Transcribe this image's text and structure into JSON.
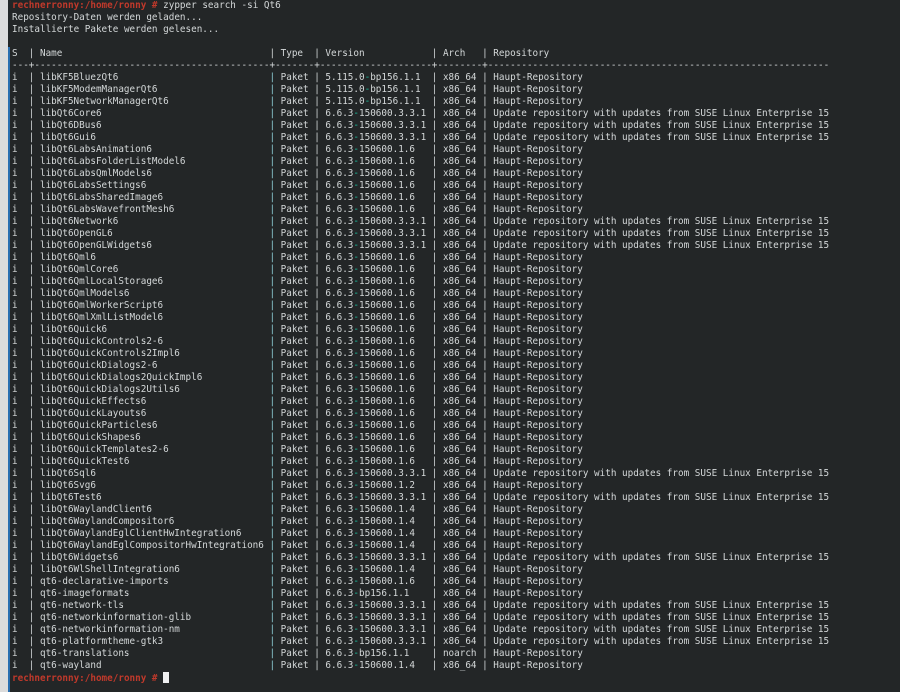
{
  "terminal": {
    "prompt": "rechnerronny:/home/ronny #",
    "command": "zypper search -si Qt6",
    "messages": [
      "Repository-Daten werden geladen...",
      "Installierte Pakete werden gelesen..."
    ],
    "headers": {
      "status": "S",
      "name": "Name",
      "type": "Type",
      "version": "Version",
      "arch": "Arch",
      "repository": "Repository"
    },
    "rows": [
      {
        "s": "i",
        "name": "libKF5BluezQt6",
        "type": "Paket",
        "ver": "5.115.0",
        "rel": "bp156.1.1",
        "arch": "x86_64",
        "repo": "Haupt-Repository"
      },
      {
        "s": "i",
        "name": "libKF5ModemManagerQt6",
        "type": "Paket",
        "ver": "5.115.0",
        "rel": "bp156.1.1",
        "arch": "x86_64",
        "repo": "Haupt-Repository"
      },
      {
        "s": "i",
        "name": "libKF5NetworkManagerQt6",
        "type": "Paket",
        "ver": "5.115.0",
        "rel": "bp156.1.1",
        "arch": "x86_64",
        "repo": "Haupt-Repository"
      },
      {
        "s": "i",
        "name": "libQt6Core6",
        "type": "Paket",
        "ver": "6.6.3",
        "rel": "150600.3.3.1",
        "arch": "x86_64",
        "repo": "Update repository with updates from SUSE Linux Enterprise 15"
      },
      {
        "s": "i",
        "name": "libQt6DBus6",
        "type": "Paket",
        "ver": "6.6.3",
        "rel": "150600.3.3.1",
        "arch": "x86_64",
        "repo": "Update repository with updates from SUSE Linux Enterprise 15"
      },
      {
        "s": "i",
        "name": "libQt6Gui6",
        "type": "Paket",
        "ver": "6.6.3",
        "rel": "150600.3.3.1",
        "arch": "x86_64",
        "repo": "Update repository with updates from SUSE Linux Enterprise 15"
      },
      {
        "s": "i",
        "name": "libQt6LabsAnimation6",
        "type": "Paket",
        "ver": "6.6.3",
        "rel": "150600.1.6",
        "arch": "x86_64",
        "repo": "Haupt-Repository"
      },
      {
        "s": "i",
        "name": "libQt6LabsFolderListModel6",
        "type": "Paket",
        "ver": "6.6.3",
        "rel": "150600.1.6",
        "arch": "x86_64",
        "repo": "Haupt-Repository"
      },
      {
        "s": "i",
        "name": "libQt6LabsQmlModels6",
        "type": "Paket",
        "ver": "6.6.3",
        "rel": "150600.1.6",
        "arch": "x86_64",
        "repo": "Haupt-Repository"
      },
      {
        "s": "i",
        "name": "libQt6LabsSettings6",
        "type": "Paket",
        "ver": "6.6.3",
        "rel": "150600.1.6",
        "arch": "x86_64",
        "repo": "Haupt-Repository"
      },
      {
        "s": "i",
        "name": "libQt6LabsSharedImage6",
        "type": "Paket",
        "ver": "6.6.3",
        "rel": "150600.1.6",
        "arch": "x86_64",
        "repo": "Haupt-Repository"
      },
      {
        "s": "i",
        "name": "libQt6LabsWavefrontMesh6",
        "type": "Paket",
        "ver": "6.6.3",
        "rel": "150600.1.6",
        "arch": "x86_64",
        "repo": "Haupt-Repository"
      },
      {
        "s": "i",
        "name": "libQt6Network6",
        "type": "Paket",
        "ver": "6.6.3",
        "rel": "150600.3.3.1",
        "arch": "x86_64",
        "repo": "Update repository with updates from SUSE Linux Enterprise 15"
      },
      {
        "s": "i",
        "name": "libQt6OpenGL6",
        "type": "Paket",
        "ver": "6.6.3",
        "rel": "150600.3.3.1",
        "arch": "x86_64",
        "repo": "Update repository with updates from SUSE Linux Enterprise 15"
      },
      {
        "s": "i",
        "name": "libQt6OpenGLWidgets6",
        "type": "Paket",
        "ver": "6.6.3",
        "rel": "150600.3.3.1",
        "arch": "x86_64",
        "repo": "Update repository with updates from SUSE Linux Enterprise 15"
      },
      {
        "s": "i",
        "name": "libQt6Qml6",
        "type": "Paket",
        "ver": "6.6.3",
        "rel": "150600.1.6",
        "arch": "x86_64",
        "repo": "Haupt-Repository"
      },
      {
        "s": "i",
        "name": "libQt6QmlCore6",
        "type": "Paket",
        "ver": "6.6.3",
        "rel": "150600.1.6",
        "arch": "x86_64",
        "repo": "Haupt-Repository"
      },
      {
        "s": "i",
        "name": "libQt6QmlLocalStorage6",
        "type": "Paket",
        "ver": "6.6.3",
        "rel": "150600.1.6",
        "arch": "x86_64",
        "repo": "Haupt-Repository"
      },
      {
        "s": "i",
        "name": "libQt6QmlModels6",
        "type": "Paket",
        "ver": "6.6.3",
        "rel": "150600.1.6",
        "arch": "x86_64",
        "repo": "Haupt-Repository"
      },
      {
        "s": "i",
        "name": "libQt6QmlWorkerScript6",
        "type": "Paket",
        "ver": "6.6.3",
        "rel": "150600.1.6",
        "arch": "x86_64",
        "repo": "Haupt-Repository"
      },
      {
        "s": "i",
        "name": "libQt6QmlXmlListModel6",
        "type": "Paket",
        "ver": "6.6.3",
        "rel": "150600.1.6",
        "arch": "x86_64",
        "repo": "Haupt-Repository"
      },
      {
        "s": "i",
        "name": "libQt6Quick6",
        "type": "Paket",
        "ver": "6.6.3",
        "rel": "150600.1.6",
        "arch": "x86_64",
        "repo": "Haupt-Repository"
      },
      {
        "s": "i",
        "name": "libQt6QuickControls2-6",
        "type": "Paket",
        "ver": "6.6.3",
        "rel": "150600.1.6",
        "arch": "x86_64",
        "repo": "Haupt-Repository"
      },
      {
        "s": "i",
        "name": "libQt6QuickControls2Impl6",
        "type": "Paket",
        "ver": "6.6.3",
        "rel": "150600.1.6",
        "arch": "x86_64",
        "repo": "Haupt-Repository"
      },
      {
        "s": "i",
        "name": "libQt6QuickDialogs2-6",
        "type": "Paket",
        "ver": "6.6.3",
        "rel": "150600.1.6",
        "arch": "x86_64",
        "repo": "Haupt-Repository"
      },
      {
        "s": "i",
        "name": "libQt6QuickDialogs2QuickImpl6",
        "type": "Paket",
        "ver": "6.6.3",
        "rel": "150600.1.6",
        "arch": "x86_64",
        "repo": "Haupt-Repository"
      },
      {
        "s": "i",
        "name": "libQt6QuickDialogs2Utils6",
        "type": "Paket",
        "ver": "6.6.3",
        "rel": "150600.1.6",
        "arch": "x86_64",
        "repo": "Haupt-Repository"
      },
      {
        "s": "i",
        "name": "libQt6QuickEffects6",
        "type": "Paket",
        "ver": "6.6.3",
        "rel": "150600.1.6",
        "arch": "x86_64",
        "repo": "Haupt-Repository"
      },
      {
        "s": "i",
        "name": "libQt6QuickLayouts6",
        "type": "Paket",
        "ver": "6.6.3",
        "rel": "150600.1.6",
        "arch": "x86_64",
        "repo": "Haupt-Repository"
      },
      {
        "s": "i",
        "name": "libQt6QuickParticles6",
        "type": "Paket",
        "ver": "6.6.3",
        "rel": "150600.1.6",
        "arch": "x86_64",
        "repo": "Haupt-Repository"
      },
      {
        "s": "i",
        "name": "libQt6QuickShapes6",
        "type": "Paket",
        "ver": "6.6.3",
        "rel": "150600.1.6",
        "arch": "x86_64",
        "repo": "Haupt-Repository"
      },
      {
        "s": "i",
        "name": "libQt6QuickTemplates2-6",
        "type": "Paket",
        "ver": "6.6.3",
        "rel": "150600.1.6",
        "arch": "x86_64",
        "repo": "Haupt-Repository"
      },
      {
        "s": "i",
        "name": "libQt6QuickTest6",
        "type": "Paket",
        "ver": "6.6.3",
        "rel": "150600.1.6",
        "arch": "x86_64",
        "repo": "Haupt-Repository"
      },
      {
        "s": "i",
        "name": "libQt6Sql6",
        "type": "Paket",
        "ver": "6.6.3",
        "rel": "150600.3.3.1",
        "arch": "x86_64",
        "repo": "Update repository with updates from SUSE Linux Enterprise 15"
      },
      {
        "s": "i",
        "name": "libQt6Svg6",
        "type": "Paket",
        "ver": "6.6.3",
        "rel": "150600.1.2",
        "arch": "x86_64",
        "repo": "Haupt-Repository"
      },
      {
        "s": "i",
        "name": "libQt6Test6",
        "type": "Paket",
        "ver": "6.6.3",
        "rel": "150600.3.3.1",
        "arch": "x86_64",
        "repo": "Update repository with updates from SUSE Linux Enterprise 15"
      },
      {
        "s": "i",
        "name": "libQt6WaylandClient6",
        "type": "Paket",
        "ver": "6.6.3",
        "rel": "150600.1.4",
        "arch": "x86_64",
        "repo": "Haupt-Repository"
      },
      {
        "s": "i",
        "name": "libQt6WaylandCompositor6",
        "type": "Paket",
        "ver": "6.6.3",
        "rel": "150600.1.4",
        "arch": "x86_64",
        "repo": "Haupt-Repository"
      },
      {
        "s": "i",
        "name": "libQt6WaylandEglClientHwIntegration6",
        "type": "Paket",
        "ver": "6.6.3",
        "rel": "150600.1.4",
        "arch": "x86_64",
        "repo": "Haupt-Repository"
      },
      {
        "s": "i",
        "name": "libQt6WaylandEglCompositorHwIntegration6",
        "type": "Paket",
        "ver": "6.6.3",
        "rel": "150600.1.4",
        "arch": "x86_64",
        "repo": "Haupt-Repository"
      },
      {
        "s": "i",
        "name": "libQt6Widgets6",
        "type": "Paket",
        "ver": "6.6.3",
        "rel": "150600.3.3.1",
        "arch": "x86_64",
        "repo": "Update repository with updates from SUSE Linux Enterprise 15"
      },
      {
        "s": "i",
        "name": "libQt6WlShellIntegration6",
        "type": "Paket",
        "ver": "6.6.3",
        "rel": "150600.1.4",
        "arch": "x86_64",
        "repo": "Haupt-Repository"
      },
      {
        "s": "i",
        "name": "qt6-declarative-imports",
        "type": "Paket",
        "ver": "6.6.3",
        "rel": "150600.1.6",
        "arch": "x86_64",
        "repo": "Haupt-Repository"
      },
      {
        "s": "i",
        "name": "qt6-imageformats",
        "type": "Paket",
        "ver": "6.6.3",
        "rel": "bp156.1.1",
        "arch": "x86_64",
        "repo": "Haupt-Repository"
      },
      {
        "s": "i",
        "name": "qt6-network-tls",
        "type": "Paket",
        "ver": "6.6.3",
        "rel": "150600.3.3.1",
        "arch": "x86_64",
        "repo": "Update repository with updates from SUSE Linux Enterprise 15"
      },
      {
        "s": "i",
        "name": "qt6-networkinformation-glib",
        "type": "Paket",
        "ver": "6.6.3",
        "rel": "150600.3.3.1",
        "arch": "x86_64",
        "repo": "Update repository with updates from SUSE Linux Enterprise 15"
      },
      {
        "s": "i",
        "name": "qt6-networkinformation-nm",
        "type": "Paket",
        "ver": "6.6.3",
        "rel": "150600.3.3.1",
        "arch": "x86_64",
        "repo": "Update repository with updates from SUSE Linux Enterprise 15"
      },
      {
        "s": "i",
        "name": "qt6-platformtheme-gtk3",
        "type": "Paket",
        "ver": "6.6.3",
        "rel": "150600.3.3.1",
        "arch": "x86_64",
        "repo": "Update repository with updates from SUSE Linux Enterprise 15"
      },
      {
        "s": "i",
        "name": "qt6-translations",
        "type": "Paket",
        "ver": "6.6.3",
        "rel": "bp156.1.1",
        "arch": "noarch",
        "repo": "Haupt-Repository"
      },
      {
        "s": "i",
        "name": "qt6-wayland",
        "type": "Paket",
        "ver": "6.6.3",
        "rel": "150600.1.4",
        "arch": "x86_64",
        "repo": "Haupt-Repository"
      }
    ]
  }
}
